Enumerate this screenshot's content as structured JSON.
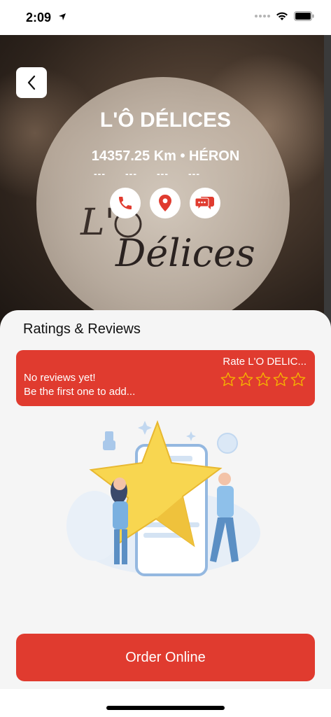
{
  "status_bar": {
    "time": "2:09"
  },
  "restaurant": {
    "name": "L'Ô DÉLICES",
    "meta": "14357.25 Km • HÉRON",
    "dashes": [
      "---",
      "---",
      "---",
      "---"
    ],
    "logo_text": "L'Ô Délices"
  },
  "ratings": {
    "title": "Ratings & Reviews",
    "rate_label": "Rate L'O DELIC...",
    "no_reviews_line1": "No reviews yet!",
    "no_reviews_line2": "Be the first one to add...",
    "stars": 0,
    "stars_max": 5
  },
  "order_button": {
    "label": "Order Online"
  },
  "colors": {
    "accent": "#e03b2f",
    "sheet_bg": "#f5f5f5",
    "star": "#f5b301"
  },
  "icons": [
    "back-arrow-icon",
    "phone-icon",
    "location-pin-icon",
    "chat-icon",
    "star-outline-icon"
  ]
}
